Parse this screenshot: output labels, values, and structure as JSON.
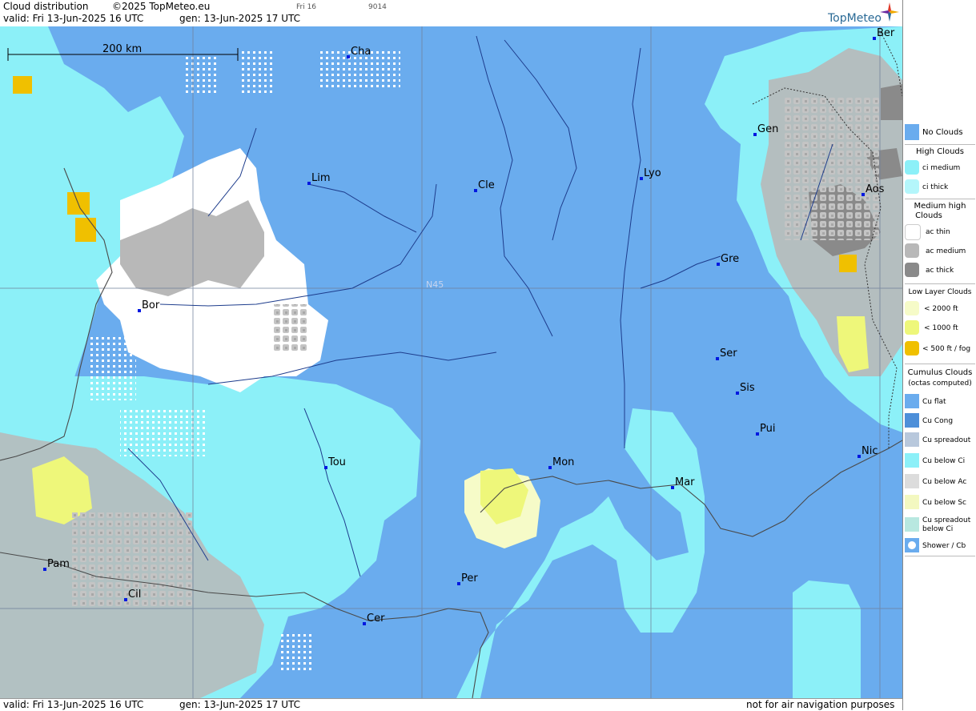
{
  "header": {
    "title": "Cloud distribution",
    "copyright": "©2025 TopMeteo.eu",
    "valid": "valid:  Fri  13-Jun-2025  16 UTC",
    "generated": "gen: 13-Jun-2025 17 UTC",
    "day_marker": "Fri 16",
    "code": "9014",
    "brand": "TopMeteo"
  },
  "map": {
    "scale_label": "200 km",
    "parallel_label": "N45",
    "colors": {
      "no_clouds": "#6aacee",
      "ci": "#8cf0f8",
      "ac_thin": "#ffffff",
      "ac_medium": "#b8b8b8",
      "ac_thick": "#8a8a8a",
      "low_2000": "#f6fbc8",
      "low_1000": "#eef77a",
      "low_500": "#f0c000"
    },
    "cities": [
      {
        "name": "Cha"
      },
      {
        "name": "Lim"
      },
      {
        "name": "Cle"
      },
      {
        "name": "Lyo"
      },
      {
        "name": "Gen"
      },
      {
        "name": "Ber"
      },
      {
        "name": "Aos"
      },
      {
        "name": "Gre"
      },
      {
        "name": "Bor"
      },
      {
        "name": "Ser"
      },
      {
        "name": "Sis"
      },
      {
        "name": "Pui"
      },
      {
        "name": "Tou"
      },
      {
        "name": "Mon"
      },
      {
        "name": "Mar"
      },
      {
        "name": "Nic"
      },
      {
        "name": "Pam"
      },
      {
        "name": "Cil"
      },
      {
        "name": "Per"
      },
      {
        "name": "Cer"
      }
    ]
  },
  "footer": {
    "valid": "valid:  Fri  13-Jun-2025  16 UTC",
    "generated": "gen: 13-Jun-2025 17 UTC",
    "disclaimer": "not for air navigation purposes"
  },
  "legend": {
    "no_clouds": "No Clouds",
    "high_title": "High Clouds",
    "ci_medium": "ci medium",
    "ci_thick": "ci thick",
    "medium_title_1": "Medium high",
    "medium_title_2": "Clouds",
    "ac_thin": "ac thin",
    "ac_medium": "ac medium",
    "ac_thick": "ac thick",
    "low_title": "Low Layer Clouds",
    "low_2000": "< 2000 ft",
    "low_1000": "< 1000 ft",
    "low_500": "< 500 ft / fog",
    "cu_title": "Cumulus Clouds",
    "cu_subtitle": "(octas computed)",
    "cu_flat": "Cu flat",
    "cu_cong": "Cu Cong",
    "cu_spreadout": "Cu spreadout",
    "cu_below_ci": "Cu below Ci",
    "cu_below_ac": "Cu below Ac",
    "cu_below_sc": "Cu below Sc",
    "cu_spreadout_below_ci_1": "Cu spreadout",
    "cu_spreadout_below_ci_2": "below Ci",
    "shower": "Shower / Cb"
  }
}
